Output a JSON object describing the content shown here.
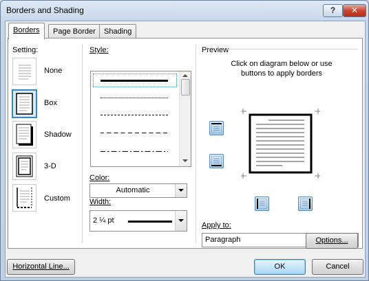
{
  "window": {
    "title": "Borders and Shading",
    "help_label": "?",
    "close_label": "✕"
  },
  "tabs": [
    {
      "label": "Borders",
      "active": true
    },
    {
      "label": "Page Border",
      "active": false
    },
    {
      "label": "Shading",
      "active": false
    }
  ],
  "setting": {
    "heading": "Setting:",
    "options": [
      {
        "label": "None",
        "selected": false
      },
      {
        "label": "Box",
        "selected": true
      },
      {
        "label": "Shadow",
        "selected": false
      },
      {
        "label": "3-D",
        "selected": false
      },
      {
        "label": "Custom",
        "selected": false
      }
    ]
  },
  "style": {
    "heading": "Style:",
    "items": [
      "solid-thick",
      "dotted",
      "dashed",
      "long-dashed",
      "dash-dot"
    ],
    "selected_index": 0
  },
  "color": {
    "heading": "Color:",
    "value": "Automatic"
  },
  "width": {
    "heading": "Width:",
    "value": "2 ¼ pt"
  },
  "preview": {
    "heading": "Preview",
    "instructions_line1": "Click on diagram below or use",
    "instructions_line2": "buttons to apply borders",
    "buttons": [
      "top-border-icon",
      "bottom-border-icon",
      "left-border-icon",
      "right-border-icon"
    ]
  },
  "apply_to": {
    "heading": "Apply to:",
    "value": "Paragraph"
  },
  "buttons": {
    "options": "Options...",
    "horizontal_line": "Horizontal Line...",
    "ok": "OK",
    "cancel": "Cancel"
  },
  "colors": {
    "accent": "#3b86c6",
    "title_bar": "#c7d7ea",
    "close_button": "#c9452f"
  }
}
